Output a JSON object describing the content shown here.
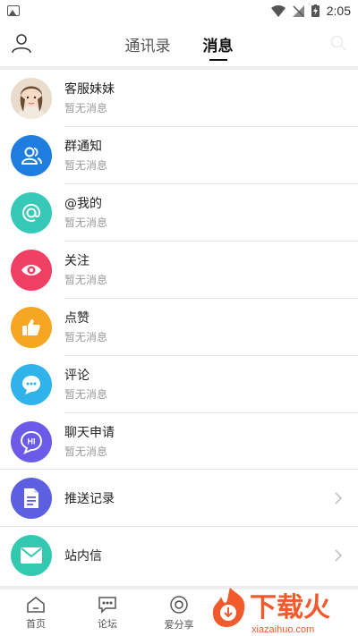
{
  "status_bar": {
    "time": "2:05"
  },
  "header": {
    "tabs": [
      {
        "label": "通讯录"
      },
      {
        "label": "消息"
      }
    ]
  },
  "messages": [
    {
      "title": "客服妹妹",
      "subtitle": "暂无消息",
      "icon": "customer-service-avatar"
    },
    {
      "title": "群通知",
      "subtitle": "暂无消息",
      "icon": "group-icon",
      "color": "#1f7de0"
    },
    {
      "title": "@我的",
      "subtitle": "暂无消息",
      "icon": "at-icon",
      "color": "#36c9b7"
    },
    {
      "title": "关注",
      "subtitle": "暂无消息",
      "icon": "eye-icon",
      "color": "#ef3f63"
    },
    {
      "title": "点赞",
      "subtitle": "暂无消息",
      "icon": "thumbs-up-icon",
      "color": "#f6a623"
    },
    {
      "title": "评论",
      "subtitle": "暂无消息",
      "icon": "comment-icon",
      "color": "#2fb3ea"
    },
    {
      "title": "聊天申请",
      "subtitle": "暂无消息",
      "icon": "chat-hi-icon",
      "color": "#6a5be8",
      "icon_text": "HI"
    }
  ],
  "extras": [
    {
      "title": "推送记录",
      "icon": "document-icon",
      "color": "#5b5fe0"
    },
    {
      "title": "站内信",
      "icon": "mail-icon",
      "color": "#33c9b1"
    }
  ],
  "bottom_nav": [
    {
      "label": "首页",
      "icon": "home-icon"
    },
    {
      "label": "论坛",
      "icon": "forum-icon"
    },
    {
      "label": "爱分享",
      "icon": "share-icon"
    }
  ],
  "watermark": {
    "text": "下载火",
    "url": "xiazaihuo.com"
  }
}
